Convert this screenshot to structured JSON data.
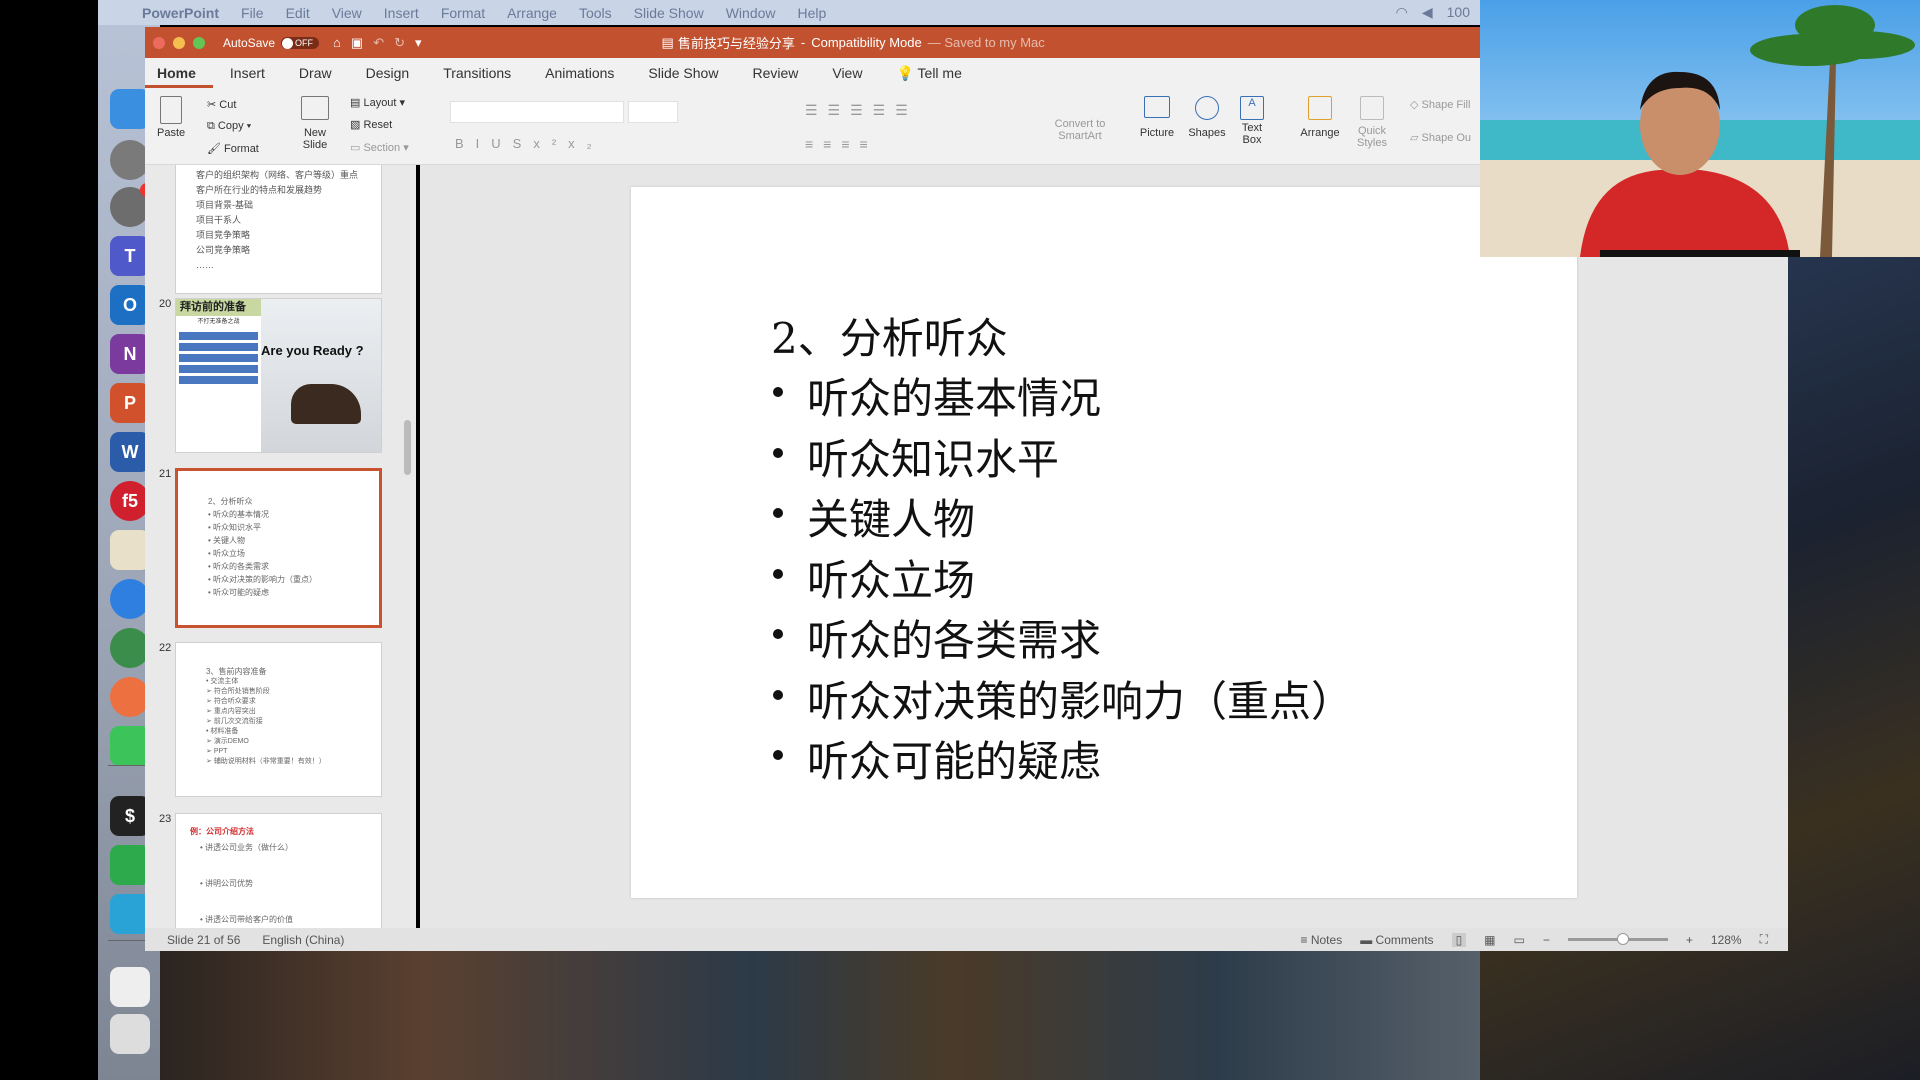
{
  "menubar": {
    "app": "PowerPoint",
    "items": [
      "File",
      "Edit",
      "View",
      "Insert",
      "Format",
      "Arrange",
      "Tools",
      "Slide Show",
      "Window",
      "Help"
    ],
    "battery": "100"
  },
  "dock": [
    {
      "name": "finder",
      "color": "#3b8fe0"
    },
    {
      "name": "launchpad",
      "color": "#7a7a7a"
    },
    {
      "name": "system-preferences",
      "color": "#6d6d6d",
      "badge": "1"
    },
    {
      "name": "teams",
      "color": "#5059c9",
      "letter": "T"
    },
    {
      "name": "outlook",
      "color": "#1d6fc4",
      "letter": "O"
    },
    {
      "name": "onenote",
      "color": "#7a3a9e",
      "letter": "N"
    },
    {
      "name": "powerpoint",
      "color": "#d2512d",
      "letter": "P"
    },
    {
      "name": "word",
      "color": "#2b5caa",
      "letter": "W"
    },
    {
      "name": "f5",
      "color": "#d0202e",
      "letter": "f5"
    },
    {
      "name": "slack",
      "color": "#e8e0c8"
    },
    {
      "name": "safari",
      "color": "#2f7fe0"
    },
    {
      "name": "chrome",
      "color": "#3a8d4a"
    },
    {
      "name": "postman",
      "color": "#ec7040"
    },
    {
      "name": "wechat",
      "color": "#3cc35a"
    },
    {
      "name": "terminal",
      "color": "#222",
      "letter": "$"
    },
    {
      "name": "evernote",
      "color": "#2daa4b"
    },
    {
      "name": "browser",
      "color": "#29a3d6"
    },
    {
      "name": "downloads",
      "color": "#eee"
    },
    {
      "name": "trash",
      "color": "#ddd"
    }
  ],
  "titlebar": {
    "autosave": "AutoSave",
    "toggle": "OFF",
    "doc_title": "售前技巧与经验分享",
    "mode": "Compatibility Mode",
    "saved": "— Saved to my Mac"
  },
  "tabs": [
    "Home",
    "Insert",
    "Draw",
    "Design",
    "Transitions",
    "Animations",
    "Slide Show",
    "Review",
    "View",
    "Tell me"
  ],
  "ribbon": {
    "paste": "Paste",
    "cut": "Cut",
    "copy": "Copy",
    "format": "Format",
    "new_slide": "New Slide",
    "layout": "Layout",
    "reset": "Reset",
    "section": "Section",
    "convert": "Convert to SmartArt",
    "picture": "Picture",
    "shapes": "Shapes",
    "text_box": "Text Box",
    "arrange": "Arrange",
    "quick_styles": "Quick Styles",
    "shape_fill": "Shape Fill",
    "shape_outline": "Shape Ou"
  },
  "thumbnails": [
    {
      "num": "",
      "lines": [
        "客户的组织架构（网络、客户等级）重点",
        "客户所在行业的特点和发展趋势",
        "项目背景-基础",
        "项目干系人",
        "项目竞争策略",
        "公司竞争策略",
        "……"
      ]
    },
    {
      "num": "20",
      "title": "拜访前的准备",
      "subtitle": "不打无准备之战",
      "image_text": "Are  you  Ready ?"
    },
    {
      "num": "21",
      "lines": [
        "2、分析听众",
        "听众的基本情况",
        "听众知识水平",
        "关键人物",
        "听众立场",
        "听众的各类需求",
        "听众对决策的影响力（重点）",
        "听众可能的疑虑"
      ]
    },
    {
      "num": "22",
      "lines": [
        "3、售前内容准备",
        "交流主体",
        "符合所处销售阶段",
        "符合听众要求",
        "重点内容突出",
        "前几次交流衔接",
        "材料准备",
        "演示DEMO",
        "PPT",
        "辅助说明材料（非常重要！有效！）"
      ]
    },
    {
      "num": "23",
      "title": "例：公司介绍方法",
      "lines": [
        "讲透公司业务（做什么）",
        "讲明公司优势",
        "讲透公司带给客户的价值"
      ]
    }
  ],
  "slide": {
    "title": "2、分析听众",
    "bullets": [
      "听众的基本情况",
      "听众知识水平",
      "关键人物",
      "听众立场",
      "听众的各类需求",
      "听众对决策的影响力（重点）",
      "听众可能的疑虑"
    ]
  },
  "status": {
    "slide": "Slide 21 of 56",
    "language": "English (China)",
    "notes": "Notes",
    "comments": "Comments",
    "zoom": "128%",
    "zoom_level": 0.55
  },
  "colors": {
    "accent": "#c2522f"
  }
}
